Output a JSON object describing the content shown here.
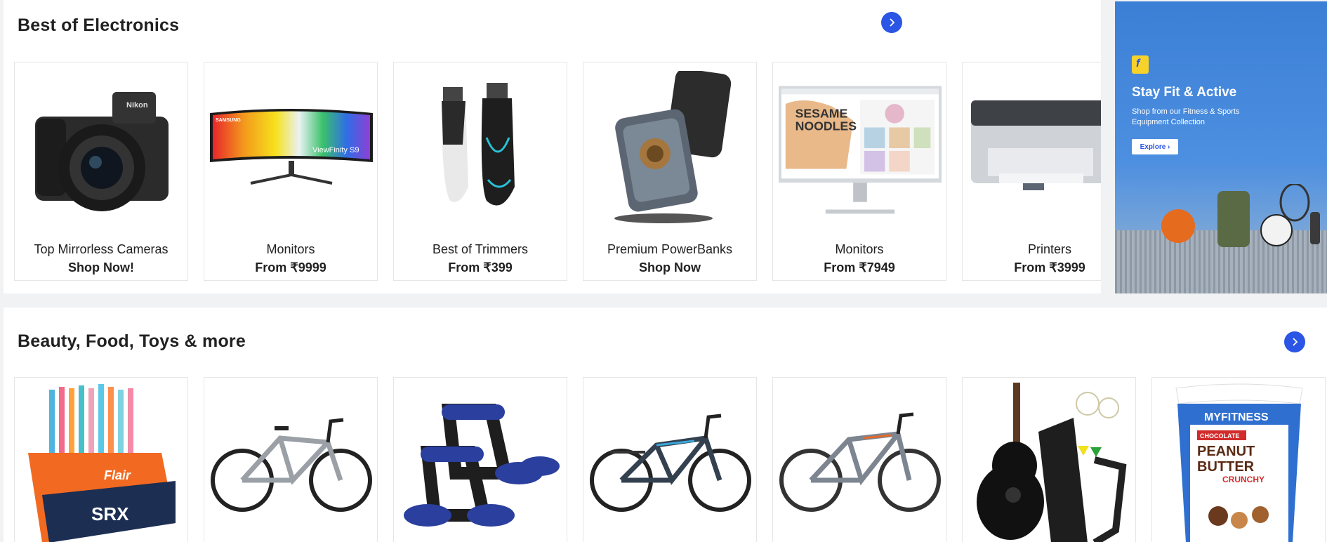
{
  "sections": [
    {
      "title": "Best of Electronics",
      "items": [
        {
          "name": "Top Mirrorless Cameras",
          "offer": "Shop Now!"
        },
        {
          "name": "Monitors",
          "offer": "From ₹9999"
        },
        {
          "name": "Best of Trimmers",
          "offer": "From ₹399"
        },
        {
          "name": "Premium PowerBanks",
          "offer": "Shop Now"
        },
        {
          "name": "Monitors",
          "offer": "From ₹7949"
        },
        {
          "name": "Printers",
          "offer": "From ₹3999"
        }
      ]
    },
    {
      "title": "Beauty, Food, Toys & more"
    }
  ],
  "banner": {
    "title": "Stay Fit & Active",
    "subtitle": "Shop from our Fitness & Sports Equipment Collection",
    "button": "Explore",
    "logo_letter": "f"
  },
  "image_text": {
    "camera_brand": "Nikon",
    "monitor_brand": "SAMSUNG",
    "monitor_model": "ViewFinity S9",
    "monitor2_line1": "SESAME",
    "monitor2_line2": "NOODLES",
    "pens_brand": "Flair",
    "pens_model": "SRX",
    "tub_brand": "MYFITNESS",
    "tub_tag": "CHOCOLATE",
    "tub_line1": "PEANUT",
    "tub_line2": "BUTTER",
    "tub_line3": "CRUNCHY"
  },
  "colors": {
    "accent": "#2a55e5",
    "banner": "#3b7fd6"
  }
}
